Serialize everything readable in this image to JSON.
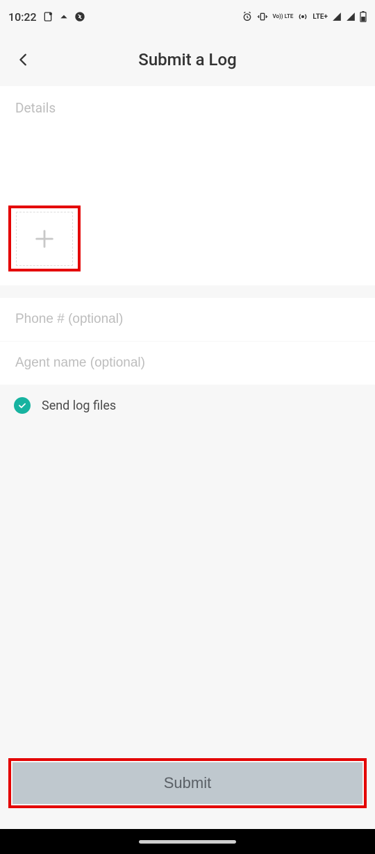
{
  "statusbar": {
    "time": "10:22",
    "lte_label": "LTE+",
    "volte_label": "Vo)) LTE"
  },
  "header": {
    "title": "Submit a Log"
  },
  "form": {
    "details_placeholder": "Details",
    "phone_placeholder": "Phone # (optional)",
    "agent_placeholder": "Agent name (optional)",
    "send_logs_label": "Send log files",
    "send_logs_checked": true,
    "submit_label": "Submit"
  }
}
